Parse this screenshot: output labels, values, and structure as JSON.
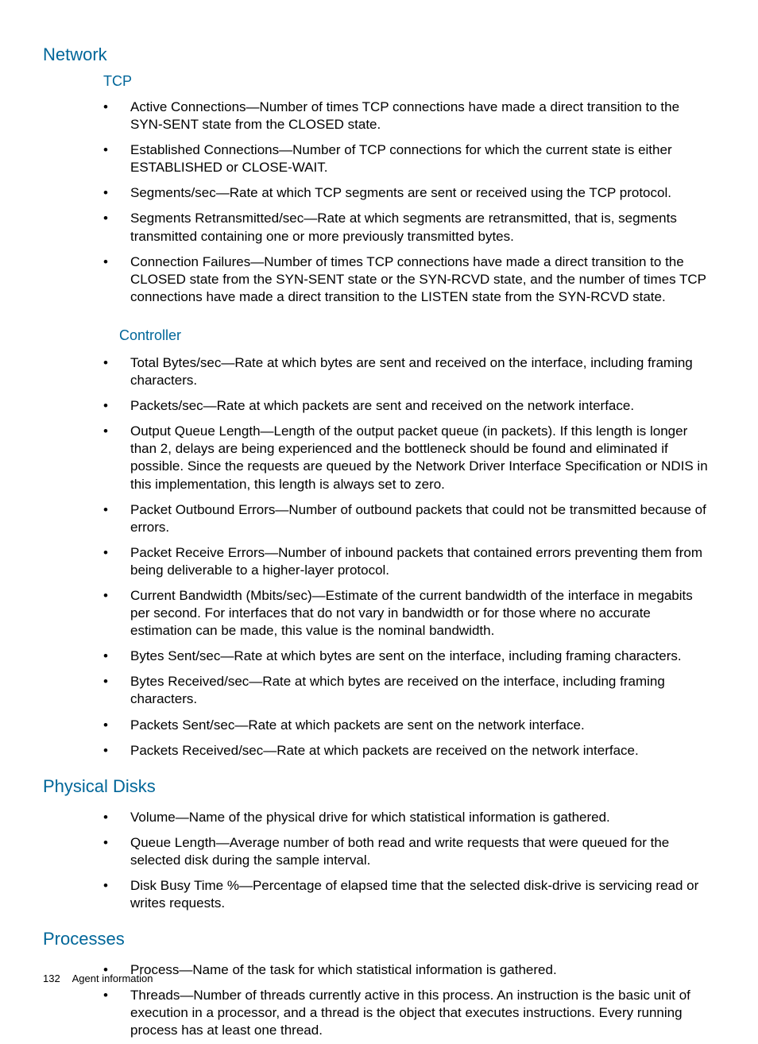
{
  "sections": {
    "network": {
      "title": "Network",
      "tcp": {
        "title": "TCP",
        "items": [
          "Active Connections—Number of times TCP connections have made a direct transition to the SYN-SENT state from the CLOSED state.",
          "Established Connections—Number of TCP connections for which the current state is either ESTABLISHED or CLOSE-WAIT.",
          "Segments/sec—Rate at which TCP segments are sent or received using the TCP protocol.",
          "Segments Retransmitted/sec—Rate at which segments are retransmitted, that is, segments transmitted containing one or more previously transmitted bytes.",
          "Connection Failures—Number of times TCP connections have made a direct transition to the CLOSED state from the SYN-SENT state or the SYN-RCVD state, and the number of times TCP connections have made a direct transition to the LISTEN state from the SYN-RCVD state."
        ]
      },
      "controller": {
        "title": "Controller",
        "items": [
          "Total Bytes/sec—Rate at which bytes are sent and received on the interface, including framing characters.",
          "Packets/sec—Rate at which packets are sent and received on the network interface.",
          "Output Queue Length—Length of the output packet queue (in packets). If this length is longer than 2, delays are being experienced and the bottleneck should be found and eliminated if possible. Since the requests are queued by the Network Driver Interface Specification or NDIS in this implementation, this length is always set to zero.",
          "Packet Outbound Errors—Number of outbound packets that could not be transmitted because of errors.",
          "Packet Receive Errors—Number of inbound packets that contained errors preventing them from being deliverable to a higher-layer protocol.",
          "Current Bandwidth (Mbits/sec)—Estimate of the current bandwidth of the interface in megabits per second. For interfaces that do not vary in bandwidth or for those where no accurate estimation can be made, this value is the nominal bandwidth.",
          "Bytes Sent/sec—Rate at which bytes are sent on the interface, including framing characters.",
          "Bytes Received/sec—Rate at which bytes are received on the interface, including framing characters.",
          "Packets Sent/sec—Rate at which packets are sent on the network interface.",
          "Packets Received/sec—Rate at which packets are received on the network interface."
        ]
      }
    },
    "physical_disks": {
      "title": "Physical Disks",
      "items": [
        "Volume—Name of the physical drive for which statistical information is gathered.",
        "Queue Length—Average number of both read and write requests that were queued for the selected disk during the sample interval.",
        "Disk Busy Time %—Percentage of elapsed time that the selected disk-drive is servicing read or writes requests."
      ]
    },
    "processes": {
      "title": "Processes",
      "items": [
        "Process—Name of the task for which statistical information is gathered.",
        "Threads—Number of threads currently active in this process. An instruction is the basic unit of execution in a processor, and a thread is the object that executes instructions. Every running process has at least one thread."
      ]
    }
  },
  "footer": {
    "page_number": "132",
    "section_title": "Agent information"
  }
}
